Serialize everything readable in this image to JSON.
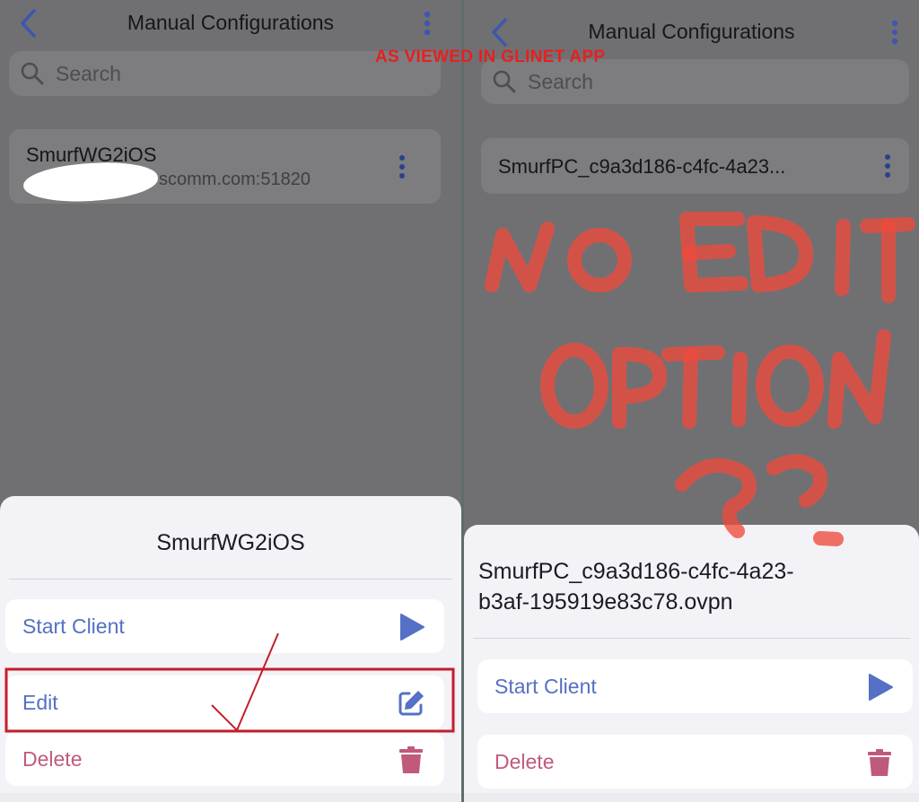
{
  "left": {
    "nav": {
      "title": "Manual Configurations"
    },
    "search": {
      "placeholder": "Search"
    },
    "config": {
      "name": "SmurfWG2iOS",
      "endpoint": "scomm.com:51820"
    },
    "sheet": {
      "title": "SmurfWG2iOS",
      "actions": [
        {
          "label": "Start Client",
          "icon": "play-icon"
        },
        {
          "label": "Edit",
          "icon": "edit-icon"
        },
        {
          "label": "Delete",
          "icon": "trash-icon"
        }
      ]
    }
  },
  "right": {
    "nav": {
      "title": "Manual Configurations"
    },
    "search": {
      "placeholder": "Search"
    },
    "config": {
      "name": "SmurfPC_c9a3d186-c4fc-4a23..."
    },
    "sheet": {
      "title_line1": "SmurfPC_c9a3d186-c4fc-4a23-",
      "title_line2": "b3af-195919e83c78.ovpn",
      "actions": [
        {
          "label": "Start Client",
          "icon": "play-icon"
        },
        {
          "label": "Delete",
          "icon": "trash-icon"
        }
      ]
    }
  },
  "annotations": {
    "caption": "AS VIEWED IN GLINET APP",
    "handwritten": "NO EDIT OPTION ??"
  },
  "colors": {
    "accent_blue": "#5570c4",
    "delete_pink": "#c05a7a",
    "annotation_red": "#e62020"
  }
}
